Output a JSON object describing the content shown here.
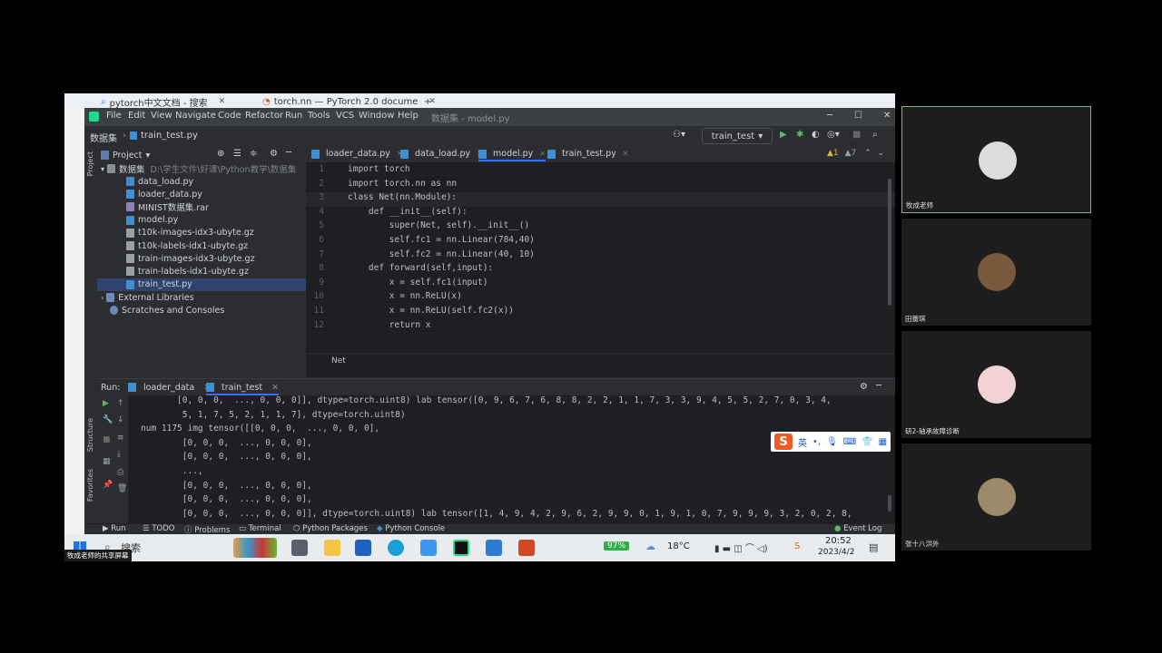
{
  "browser": {
    "tabs": [
      {
        "title": "pytorch中文文档 - 搜索"
      },
      {
        "title": "torch.nn — PyTorch 2.0 docume"
      }
    ]
  },
  "ide": {
    "menu": [
      "File",
      "Edit",
      "View",
      "Navigate",
      "Code",
      "Refactor",
      "Run",
      "Tools",
      "VCS",
      "Window",
      "Help"
    ],
    "window_title": "数据集 - model.py",
    "breadcrumb": [
      "数据集",
      "train_test.py"
    ],
    "run_config": "train_test",
    "project_header": "Project",
    "tree": {
      "root": "数据集",
      "root_path": "D:\\学生文件\\好课\\Python教学\\数据集",
      "files": [
        "data_load.py",
        "loader_data.py",
        "MINIST数据集.rar",
        "model.py",
        "t10k-images-idx3-ubyte.gz",
        "t10k-labels-idx1-ubyte.gz",
        "train-images-idx3-ubyte.gz",
        "train-labels-idx1-ubyte.gz",
        "train_test.py"
      ],
      "selected": "train_test.py",
      "external": "External Libraries",
      "scratches": "Scratches and Consoles"
    },
    "editor_tabs": [
      "loader_data.py",
      "data_load.py",
      "model.py",
      "train_test.py"
    ],
    "active_tab": "model.py",
    "warnings": {
      "a": "1",
      "b": "7"
    },
    "code_lines": [
      {
        "n": "1",
        "text": "import torch"
      },
      {
        "n": "2",
        "text": "import torch.nn as nn"
      },
      {
        "n": "3",
        "text": "class Net(nn.Module):"
      },
      {
        "n": "4",
        "text": "    def __init__(self):"
      },
      {
        "n": "5",
        "text": "        super(Net, self).__init__()"
      },
      {
        "n": "6",
        "text": "        self.fc1 = nn.Linear(784,40)"
      },
      {
        "n": "7",
        "text": "        self.fc2 = nn.Linear(40, 10)"
      },
      {
        "n": "8",
        "text": "    def forward(self,input):"
      },
      {
        "n": "9",
        "text": "        x = self.fc1(input)"
      },
      {
        "n": "10",
        "text": "        x = nn.ReLU(x)"
      },
      {
        "n": "11",
        "text": "        x = nn.ReLU(self.fc2(x))"
      },
      {
        "n": "12",
        "text": "        return x"
      }
    ],
    "editor_breadcrumb": "Net",
    "run": {
      "label": "Run:",
      "tabs": [
        "loader_data",
        "train_test"
      ],
      "output": [
        "       [0, 0, 0,  ..., 0, 0, 0]], dtype=torch.uint8) lab tensor([0, 9, 6, 7, 6, 8, 8, 2, 2, 1, 1, 7, 3, 3, 9, 4, 5, 5, 2, 7, 0, 3, 4,",
        "        5, 1, 7, 5, 2, 1, 1, 7], dtype=torch.uint8)",
        "num 1175 img tensor([[0, 0, 0,  ..., 0, 0, 0],",
        "        [0, 0, 0,  ..., 0, 0, 0],",
        "        [0, 0, 0,  ..., 0, 0, 0],",
        "        ...,",
        "        [0, 0, 0,  ..., 0, 0, 0],",
        "        [0, 0, 0,  ..., 0, 0, 0],",
        "        [0, 0, 0,  ..., 0, 0, 0]], dtype=torch.uint8) lab tensor([1, 4, 9, 4, 2, 9, 6, 2, 9, 9, 0, 1, 9, 1, 0, 7, 9, 9, 9, 3, 2, 0, 2, 8,"
      ]
    },
    "bottom_tabs": [
      "Run",
      "TODO",
      "Problems",
      "Terminal",
      "Python Packages",
      "Python Console"
    ],
    "event_log": "Event Log",
    "side_labels": {
      "project": "Project",
      "structure": "Structure",
      "favorites": "Favorites"
    }
  },
  "ime": {
    "lang": "英"
  },
  "taskbar": {
    "search": "搜索",
    "battery": "97%",
    "weather": "18°C",
    "time": "20:52",
    "date": "2023/4/2",
    "sharing": "牧成老师的共享屏幕"
  },
  "participants": [
    {
      "name": "牧成老师",
      "color": "#dcdcdc"
    },
    {
      "name": "田蕾琪",
      "color": "#7a5a3c"
    },
    {
      "name": "研2-轴承故障诊断",
      "color": "#f3d2d6"
    },
    {
      "name": "张十八洪外",
      "color": "#9b8a6a"
    }
  ],
  "colors": {
    "active_border": "#6fc16f",
    "selection": "#2e436e",
    "keyword": "#cf8e6d"
  }
}
